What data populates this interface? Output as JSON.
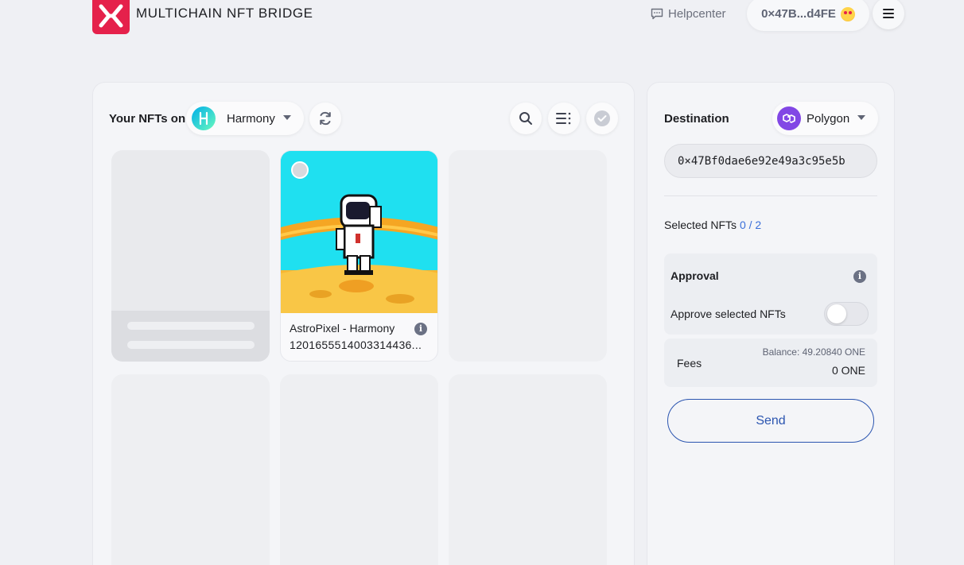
{
  "header": {
    "brand": "MULTICHAIN NFT BRIDGE",
    "help_label": "Helpcenter",
    "wallet_address": "0×47B...d4FE",
    "icons": {
      "logo": "xp-logo-icon",
      "help": "chat-icon",
      "menu": "hamburger-icon",
      "wallet_avatar": "emoji-avatar-icon"
    }
  },
  "nft_panel": {
    "title": "Your NFTs on",
    "source_chain": "Harmony",
    "icons": {
      "chain": "harmony-logo-icon",
      "refresh": "refresh-icon",
      "search": "search-icon",
      "list": "list-view-icon",
      "select_all": "check-circle-icon"
    },
    "nfts": [
      {
        "name": "AstroPixel - Harmony",
        "token_id": "1201655514003314436...",
        "selected": false
      }
    ]
  },
  "transfer_panel": {
    "destination_label": "Destination",
    "destination_chain": "Polygon",
    "address_value": "0×47Bf0dae6e92e49a3c95e5b",
    "selected_label": "Selected NFTs",
    "selected_count": "0 / 2",
    "approval_title": "Approval",
    "approve_label": "Approve selected NFTs",
    "approve_on": false,
    "fees_label": "Fees",
    "balance": "Balance: 49.20840 ONE",
    "fee_value": "0 ONE",
    "send_label": "Send",
    "colors": {
      "accent": "#2b55b0",
      "polygon": "#8247e5",
      "brand": "#e5214b"
    }
  }
}
